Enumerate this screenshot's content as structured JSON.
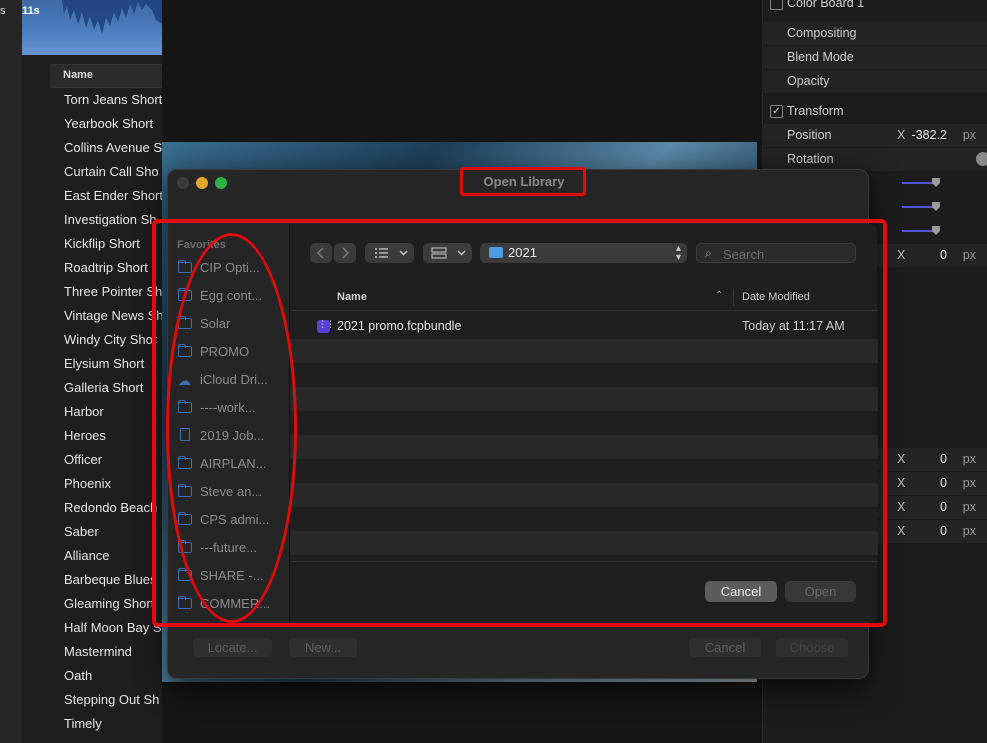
{
  "browser": {
    "left_label": "s",
    "timecode": "11s",
    "column_header": "Name",
    "clips": [
      "Torn Jeans Short",
      "Yearbook Short",
      "Collins Avenue S",
      "Curtain Call Sho",
      "East Ender Short",
      "Investigation Sh",
      "Kickflip Short",
      "Roadtrip Short",
      "Three Pointer Sh",
      "Vintage News Sh",
      "Windy City Shor",
      "Elysium Short",
      "Galleria Short",
      "Harbor",
      "Heroes",
      "Officer",
      "Phoenix",
      "Redondo Beach",
      "Saber",
      "Alliance",
      "Barbeque Blues",
      "Gleaming Short",
      "Half Moon Bay S",
      "Mastermind",
      "Oath",
      "Stepping Out Sh",
      "Timely"
    ]
  },
  "inspector": {
    "color_board": "Color Board 1",
    "compositing": "Compositing",
    "blend_mode": "Blend Mode",
    "opacity": "Opacity",
    "transform": "Transform",
    "position": "Position",
    "position_axis": "X",
    "position_value": "-382.2",
    "position_unit": "px",
    "rotation": "Rotation",
    "rows": [
      {
        "axis": "X",
        "value": "0",
        "unit": "px"
      },
      {
        "axis": "X",
        "value": "0",
        "unit": "px"
      },
      {
        "axis": "X",
        "value": "0",
        "unit": "px"
      },
      {
        "axis": "X",
        "value": "0",
        "unit": "px"
      },
      {
        "axis": "X",
        "value": "0",
        "unit": "px"
      }
    ]
  },
  "dialog": {
    "title": "Open Library",
    "favorites_label": "Favorites",
    "sidebar": [
      {
        "label": "CIP Opti...",
        "icon": "folder-icon"
      },
      {
        "label": "Egg cont...",
        "icon": "folder-icon"
      },
      {
        "label": "Solar",
        "icon": "folder-icon"
      },
      {
        "label": "PROMO",
        "icon": "folder-icon"
      },
      {
        "label": "iCloud Dri...",
        "icon": "cloud-icon"
      },
      {
        "label": "----work...",
        "icon": "folder-icon"
      },
      {
        "label": "2019 Job...",
        "icon": "document-icon"
      },
      {
        "label": "AIRPLAN...",
        "icon": "folder-icon"
      },
      {
        "label": "Steve an...",
        "icon": "folder-icon"
      },
      {
        "label": "CPS admi...",
        "icon": "folder-icon"
      },
      {
        "label": "---future...",
        "icon": "folder-icon"
      },
      {
        "label": "SHARE -...",
        "icon": "folder-icon"
      },
      {
        "label": "COMMER...",
        "icon": "folder-icon"
      }
    ],
    "path": "2021",
    "search_placeholder": "Search",
    "columns": {
      "name": "Name",
      "date": "Date Modified"
    },
    "files": [
      {
        "name": "2021 promo.fcpbundle",
        "date": "Today at 11:17 AM",
        "icon": "fcpbundle-icon"
      }
    ],
    "cancel": "Cancel",
    "open": "Open",
    "locate": "Locate...",
    "new": "New...",
    "outer_cancel": "Cancel",
    "choose": "Choose"
  },
  "colors": {
    "annotation": "#e10b0b",
    "accent_folder": "#4a9be4",
    "slider": "#5a5ad8"
  }
}
